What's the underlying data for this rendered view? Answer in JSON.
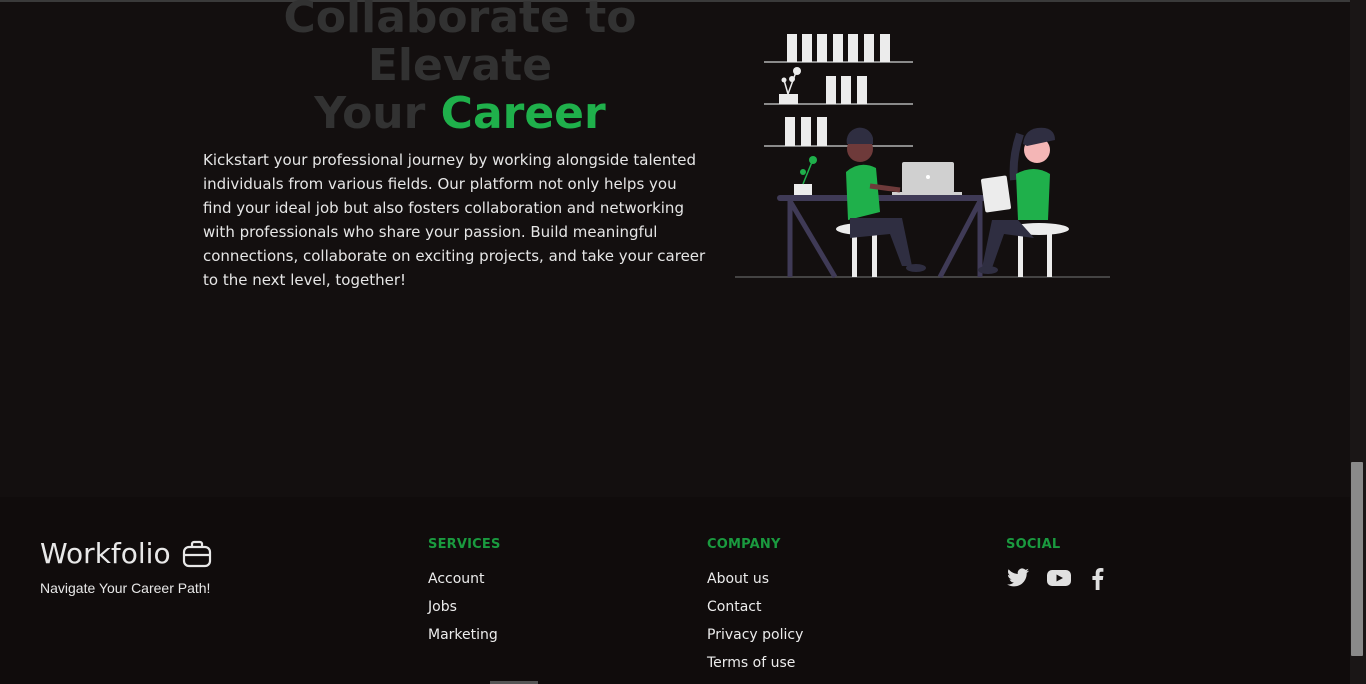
{
  "hero": {
    "title_line1": "Collaborate to Elevate",
    "title_line2_plain": "Your ",
    "title_line2_accent": "Career",
    "description": "Kickstart your professional journey by working alongside talented individuals from various fields. Our platform not only helps you find your ideal job but also fosters collaboration and networking with professionals who share your passion. Build meaningful connections, collaborate on exciting projects, and take your career to the next level, together!"
  },
  "footer": {
    "brand": {
      "name": "Workfolio",
      "icon": "briefcase-icon",
      "tagline": "Navigate Your Career Path!"
    },
    "services": {
      "title": "SERVICES",
      "links": [
        "Account",
        "Jobs",
        "Marketing"
      ]
    },
    "company": {
      "title": "COMPANY",
      "links": [
        "About us",
        "Contact",
        "Privacy policy",
        "Terms of use"
      ]
    },
    "social": {
      "title": "SOCIAL",
      "icons": [
        "twitter-icon",
        "youtube-icon",
        "facebook-icon"
      ]
    }
  },
  "colors": {
    "background": "#130f0f",
    "accent": "#1fb04b",
    "section_title": "#1a9a3f",
    "muted_title": "#323232",
    "text": "#e6e6e6"
  }
}
